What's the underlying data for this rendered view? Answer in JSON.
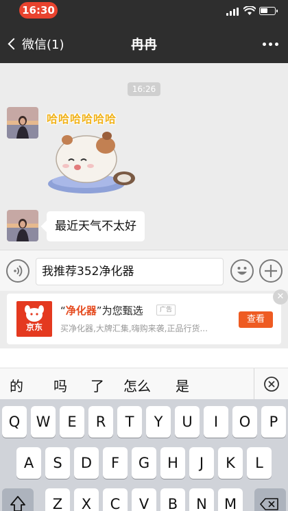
{
  "status_bar": {
    "time": "16:30"
  },
  "nav": {
    "back_label": "微信(1)",
    "title": "冉冉"
  },
  "chat": {
    "timestamp": "16:26",
    "sticker_caption": "哈哈哈哈哈哈",
    "message": "最近天气不太好"
  },
  "composer": {
    "input_value": "我推荐352净化器"
  },
  "ad": {
    "title_quote_open": "“",
    "title_highlight": "净化器",
    "title_rest": "”为您甄选",
    "tag": "广告",
    "description": "买净化器,大牌汇集,嗨购来袭,正品行货...",
    "cta": "查看",
    "logo_text": "京东"
  },
  "candidates": [
    "的",
    "吗",
    "了",
    "怎么",
    "是"
  ],
  "keyboard": {
    "row1": [
      "Q",
      "W",
      "E",
      "R",
      "T",
      "Y",
      "U",
      "I",
      "O",
      "P"
    ],
    "row2": [
      "A",
      "S",
      "D",
      "F",
      "G",
      "H",
      "J",
      "K",
      "L"
    ],
    "row3": [
      "Z",
      "X",
      "C",
      "V",
      "B",
      "N",
      "M"
    ]
  },
  "colors": {
    "ad_accent": "#ee5b22",
    "time_pill": "#e8432e",
    "sticker_text": "#f0b21b"
  }
}
